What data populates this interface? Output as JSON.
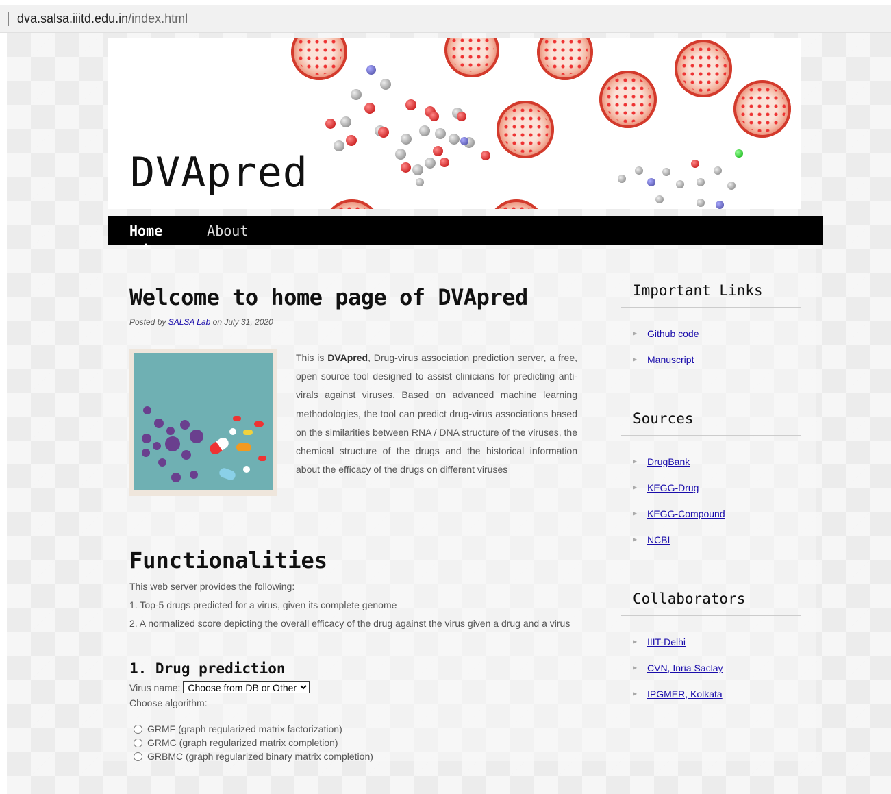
{
  "browser": {
    "url_domain": "dva.salsa.iiitd.edu.in",
    "url_path": "/index.html"
  },
  "header": {
    "site_title": "DVApred"
  },
  "nav": {
    "items": [
      {
        "label": "Home",
        "active": true
      },
      {
        "label": "About",
        "active": false
      }
    ]
  },
  "post": {
    "title": "Welcome to home page of DVApred",
    "byline_prefix": "Posted by",
    "author": "SALSA Lab",
    "byline_date": "on July 31, 2020",
    "intro_lead": "This is ",
    "intro_bold": "DVApred",
    "intro_rest": ", Drug-virus association prediction server, a free, open source tool designed to assist clinicians for predicting anti-virals against viruses. Based on advanced machine learning methodologies, the tool can predict drug-virus associations based on the similarities between RNA / DNA structure of the viruses, the chemical structure of the drugs and the historical information about the efficacy of the drugs on different viruses"
  },
  "functionalities": {
    "title": "Functionalities",
    "lead": "This web server provides the following:",
    "items": [
      "1. Top-5 drugs predicted for a virus, given its complete genome",
      "2. A normalized score depicting the overall efficacy of the drug against the virus given a drug and a virus"
    ]
  },
  "drug_prediction": {
    "title": "1. Drug prediction",
    "virus_label": "Virus name:",
    "virus_select_value": "Choose from DB or Other",
    "algorithm_label": "Choose algorithm:",
    "algorithms": [
      "GRMF (graph regularized matrix factorization)",
      "GRMC (graph regularized matrix completion)",
      "GRBMC (graph regularized binary matrix completion)"
    ]
  },
  "sidebar": {
    "widgets": [
      {
        "title": "Important Links",
        "links": [
          "Github code",
          "Manuscript"
        ]
      },
      {
        "title": "Sources",
        "links": [
          "DrugBank",
          "KEGG-Drug",
          "KEGG-Compound",
          "NCBI"
        ]
      },
      {
        "title": "Collaborators",
        "links": [
          "IIIT-Delhi",
          "CVN, Inria Saclay",
          "IPGMER, Kolkata"
        ]
      }
    ]
  },
  "colors": {
    "nav_bg": "#000000",
    "link": "#1a0dab",
    "virus_red": "#c8281c",
    "thumb_bg": "#6fb0b3"
  },
  "icons": {
    "list_bullet": "triangle-right-icon"
  }
}
